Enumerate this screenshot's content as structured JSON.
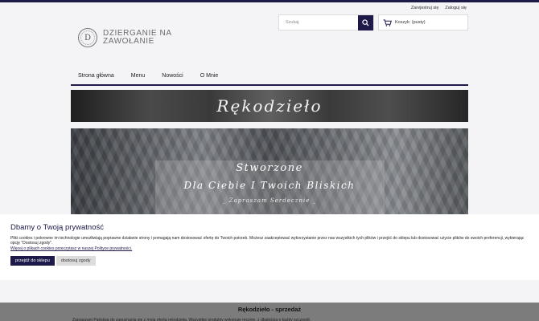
{
  "header": {
    "links": [
      "Zarejestruj się",
      "Zaloguj się"
    ],
    "logo_letter": "D",
    "logo_text": "DZIERGANIE NA ZAWOŁANIE",
    "search": {
      "placeholder": "Szukaj"
    },
    "cart": {
      "label": "Koszyk: (pusty)"
    }
  },
  "nav": {
    "items": [
      "Strona główna",
      "Menu",
      "Nowości",
      "O Mnie"
    ]
  },
  "banner1": {
    "text": "Rękodzieło"
  },
  "banner2": {
    "line1": "Stworzone",
    "line2": "Dla Ciebie I Twoich Bliskich",
    "line3": "_ Zapraszam Serdecznie _"
  },
  "cookie": {
    "title": "Dbamy o Twoją prywatność",
    "body": "Pliki cookies i pokrewne im technologie umożliwiają poprawne działanie strony i pomagają nam dostosować ofertę do Twoich potrzeb. Możesz zaakceptować wykorzystanie przez nas wszystkich tych plików i przejść do sklepu lub dostosować użycie plików do swoich preferencji, wybierając opcję \"Dostosuj zgody\".",
    "link": "Więcej o plikach cookies przeczytasz w naszej Polityce prywatności.",
    "accept": "przejdź do sklepu",
    "adjust": "dostosuj zgody"
  },
  "section": {
    "title": "Rękodzieło - sprzedaż",
    "text": "Zapraszam Państwa do zapoznania się z moją ofertą rękodzieła. Wszystkie produkty wykonuję ręcznie, z dbałością o każdy szczegół."
  },
  "colors": {
    "accent": "#1d1a4a",
    "overlay": "#7c7c7c"
  }
}
